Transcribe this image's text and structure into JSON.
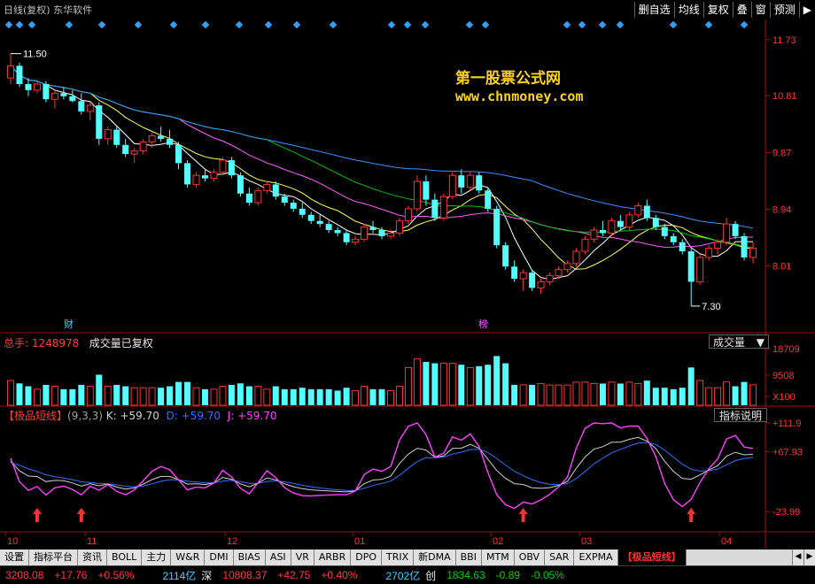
{
  "topbar": {
    "title": "日线(复权) 东华软件",
    "buttons": [
      "删自选",
      "均线",
      "复权",
      "叠",
      "窗",
      "预测",
      "▶"
    ]
  },
  "watermark": {
    "line1": "第一股票公式网",
    "line2": "www.chnmoney.com"
  },
  "main_chart": {
    "y_labels": [
      "11.73",
      "10.81",
      "9.87",
      "8.94",
      "8.01"
    ],
    "high_label": "11.50",
    "low_label": "7.30",
    "tag_cai": "财",
    "tag_bang": "榜"
  },
  "volume_panel": {
    "total_label": "总手: 1248978",
    "note": "成交量已复权",
    "dropdown": "成交量",
    "y_labels": [
      "18709",
      "9508",
      "X100"
    ]
  },
  "kdj_panel": {
    "name": "【极品短线】",
    "params": "(9,3,3)",
    "k": "K: +59.70",
    "d": "D: +59.70",
    "j": "J: +59.70",
    "explain": "指标说明",
    "y_labels": [
      "+111.9",
      "+67.93",
      "-23.99"
    ]
  },
  "x_axis": [
    "10",
    "11",
    "12",
    "01",
    "02",
    "03",
    "04"
  ],
  "tabs": [
    "设置",
    "指标平台",
    "资讯",
    "BOLL",
    "主力",
    "W&R",
    "DMI",
    "BIAS",
    "ASI",
    "VR",
    "ARBR",
    "DPO",
    "TRIX",
    "新DMA",
    "BBI",
    "MTM",
    "OBV",
    "SAR",
    "EXPMA",
    "【极品短线】"
  ],
  "active_tab": "【极品短线】",
  "statusbar": {
    "sh_index": "3208.08",
    "sh_change": "+17.76",
    "sh_pct": "+0.56%",
    "sh_amount": "2114亿",
    "sz_name": "深",
    "sz_index": "10808.37",
    "sz_change": "+42.75",
    "sz_pct": "+0.40%",
    "sz_amount": "2702亿",
    "cy_name": "创",
    "cy_index": "1834.63",
    "cy_change": "-0.89",
    "cy_pct": "-0.05%"
  },
  "colors": {
    "up": "#ff3232",
    "down": "#54ffff",
    "axis": "#a01010",
    "ma5": "#ffffff",
    "ma10": "#ffff60",
    "ma20": "#ff60ff",
    "ma30": "#00c000",
    "ma60": "#4090ff",
    "k": "#d0d0d0",
    "d": "#3070ff",
    "j": "#ff40ff"
  },
  "chart_data": {
    "type": "candlestick",
    "ylim": [
      7.0,
      11.8
    ],
    "candles": [
      [
        11.1,
        11.5,
        11.0,
        11.3
      ],
      [
        11.3,
        11.35,
        10.95,
        11.0
      ],
      [
        11.0,
        11.1,
        10.8,
        10.9
      ],
      [
        10.9,
        11.05,
        10.85,
        11.0
      ],
      [
        11.0,
        11.05,
        10.7,
        10.75
      ],
      [
        10.75,
        10.9,
        10.6,
        10.85
      ],
      [
        10.85,
        10.95,
        10.75,
        10.8
      ],
      [
        10.8,
        10.9,
        10.7,
        10.72
      ],
      [
        10.72,
        10.85,
        10.5,
        10.55
      ],
      [
        10.55,
        10.7,
        10.4,
        10.65
      ],
      [
        10.65,
        10.7,
        10.0,
        10.1
      ],
      [
        10.1,
        10.3,
        10.0,
        10.25
      ],
      [
        10.25,
        10.3,
        9.95,
        10.0
      ],
      [
        10.0,
        10.1,
        9.8,
        9.85
      ],
      [
        9.85,
        9.95,
        9.7,
        9.9
      ],
      [
        9.9,
        10.1,
        9.85,
        10.05
      ],
      [
        10.05,
        10.2,
        9.95,
        10.15
      ],
      [
        10.15,
        10.3,
        10.05,
        10.1
      ],
      [
        10.1,
        10.25,
        9.95,
        10.0
      ],
      [
        10.0,
        10.05,
        9.6,
        9.7
      ],
      [
        9.7,
        9.75,
        9.3,
        9.35
      ],
      [
        9.35,
        9.55,
        9.3,
        9.5
      ],
      [
        9.5,
        9.6,
        9.4,
        9.45
      ],
      [
        9.45,
        9.6,
        9.4,
        9.55
      ],
      [
        9.55,
        9.8,
        9.5,
        9.75
      ],
      [
        9.75,
        9.8,
        9.45,
        9.5
      ],
      [
        9.5,
        9.55,
        9.15,
        9.2
      ],
      [
        9.2,
        9.3,
        9.0,
        9.05
      ],
      [
        9.05,
        9.3,
        9.0,
        9.25
      ],
      [
        9.25,
        9.4,
        9.2,
        9.35
      ],
      [
        9.35,
        9.4,
        9.1,
        9.15
      ],
      [
        9.15,
        9.2,
        9.0,
        9.05
      ],
      [
        9.05,
        9.1,
        8.9,
        8.95
      ],
      [
        8.95,
        9.05,
        8.8,
        8.85
      ],
      [
        8.85,
        8.9,
        8.7,
        8.75
      ],
      [
        8.75,
        8.85,
        8.65,
        8.7
      ],
      [
        8.7,
        8.75,
        8.55,
        8.6
      ],
      [
        8.6,
        8.65,
        8.5,
        8.55
      ],
      [
        8.55,
        8.6,
        8.35,
        8.4
      ],
      [
        8.4,
        8.5,
        8.35,
        8.45
      ],
      [
        8.45,
        8.7,
        8.4,
        8.65
      ],
      [
        8.65,
        8.75,
        8.55,
        8.6
      ],
      [
        8.6,
        8.65,
        8.45,
        8.5
      ],
      [
        8.5,
        8.6,
        8.45,
        8.55
      ],
      [
        8.55,
        8.8,
        8.5,
        8.75
      ],
      [
        8.75,
        9.0,
        8.7,
        8.95
      ],
      [
        8.95,
        9.5,
        8.9,
        9.4
      ],
      [
        9.4,
        9.5,
        9.0,
        9.1
      ],
      [
        9.1,
        9.2,
        8.75,
        8.8
      ],
      [
        8.8,
        9.2,
        8.75,
        9.15
      ],
      [
        9.15,
        9.55,
        9.1,
        9.5
      ],
      [
        9.5,
        9.6,
        9.2,
        9.3
      ],
      [
        9.3,
        9.55,
        9.25,
        9.5
      ],
      [
        9.5,
        9.55,
        9.2,
        9.25
      ],
      [
        9.25,
        9.3,
        8.9,
        8.95
      ],
      [
        8.95,
        9.0,
        8.3,
        8.35
      ],
      [
        8.35,
        8.4,
        7.95,
        8.0
      ],
      [
        8.0,
        8.1,
        7.75,
        7.8
      ],
      [
        7.8,
        7.95,
        7.6,
        7.9
      ],
      [
        7.9,
        7.95,
        7.6,
        7.65
      ],
      [
        7.65,
        7.8,
        7.55,
        7.75
      ],
      [
        7.75,
        7.9,
        7.7,
        7.85
      ],
      [
        7.85,
        8.0,
        7.8,
        7.95
      ],
      [
        7.95,
        8.1,
        7.9,
        8.05
      ],
      [
        8.05,
        8.3,
        8.0,
        8.25
      ],
      [
        8.25,
        8.5,
        8.2,
        8.45
      ],
      [
        8.45,
        8.65,
        8.4,
        8.6
      ],
      [
        8.6,
        8.75,
        8.5,
        8.55
      ],
      [
        8.55,
        8.8,
        8.5,
        8.75
      ],
      [
        8.75,
        8.85,
        8.6,
        8.65
      ],
      [
        8.65,
        8.9,
        8.6,
        8.85
      ],
      [
        8.85,
        9.05,
        8.8,
        9.0
      ],
      [
        9.0,
        9.1,
        8.75,
        8.8
      ],
      [
        8.8,
        8.85,
        8.6,
        8.65
      ],
      [
        8.65,
        8.7,
        8.45,
        8.5
      ],
      [
        8.5,
        8.55,
        8.35,
        8.4
      ],
      [
        8.4,
        8.45,
        8.2,
        8.25
      ],
      [
        8.25,
        8.3,
        7.35,
        7.75
      ],
      [
        7.75,
        8.2,
        7.7,
        8.15
      ],
      [
        8.15,
        8.35,
        8.1,
        8.3
      ],
      [
        8.3,
        8.45,
        8.2,
        8.4
      ],
      [
        8.4,
        8.8,
        8.35,
        8.7
      ],
      [
        8.7,
        8.75,
        8.45,
        8.5
      ],
      [
        8.5,
        8.55,
        8.1,
        8.15
      ],
      [
        8.15,
        8.4,
        8.05,
        8.3
      ]
    ]
  }
}
